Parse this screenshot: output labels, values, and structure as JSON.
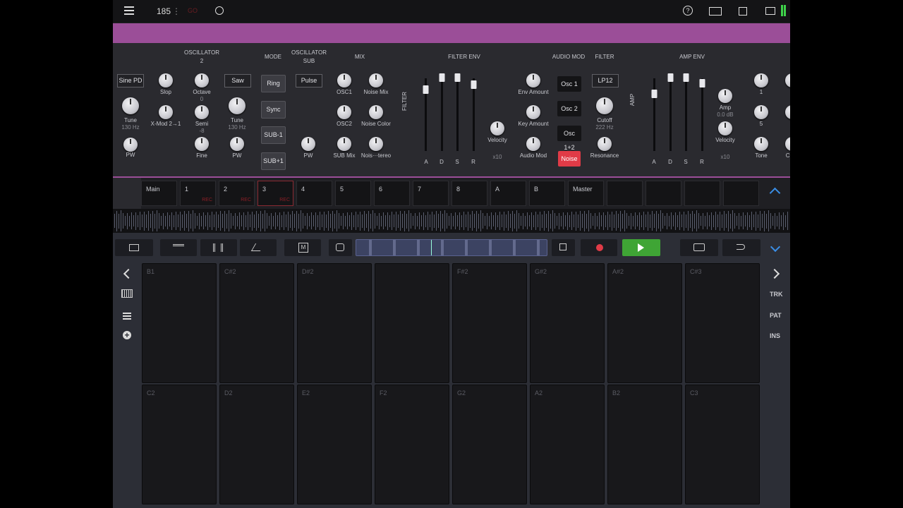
{
  "topbar": {
    "bpm": "185",
    "rec_label": "GO",
    "bpm_dots": "⋮"
  },
  "synth": {
    "headers": {
      "osc2": "OSCILLATOR\n2",
      "mode": "MODE",
      "oscsub": "OSCILLATOR\nSUB",
      "mix": "MIX",
      "filter_env": "FILTER ENV",
      "audio_mod": "AUDIO MOD",
      "filter": "FILTER",
      "amp_env": "AMP ENV",
      "filter_side": "FILTER",
      "amp_side": "AMP"
    },
    "osc1_wave": "Sine PD",
    "osc2_wave": "Saw",
    "sub_wave": "Pulse",
    "filter_type": "LP12",
    "mode_buttons": [
      "Ring",
      "Sync",
      "SUB-1",
      "SUB+1"
    ],
    "audio_mod_buttons": [
      "Osc 1",
      "Osc 2",
      "Osc 1+2",
      "Noise"
    ],
    "knobs": {
      "slop": "Slop",
      "octave": "Octave",
      "octave_val": "0",
      "tune1": "Tune",
      "tune1_val": "130 Hz",
      "xmod": "X-Mod 2→1",
      "semi": "Semi",
      "semi_val": "-8",
      "tune2": "Tune",
      "tune2_val": "130 Hz",
      "pw1": "PW",
      "fine": "Fine",
      "pw2": "PW",
      "pw3": "PW",
      "osc1": "OSC1",
      "noise_mix": "Noise Mix",
      "osc2": "OSC2",
      "noise_color": "Noise Color",
      "sub_mix": "SUB Mix",
      "noise_stereo": "Nois···tereo",
      "fe_velocity": "Velocity",
      "fe_x": "x10",
      "env_amount": "Env Amount",
      "key_amount": "Key Amount",
      "audio_mod": "Audio Mod",
      "cutoff": "Cutoff",
      "cutoff_val": "222 Hz",
      "resonance": "Resonance",
      "amp": "Amp",
      "amp_val": "0.0 dB",
      "amp_velocity": "Velocity",
      "amp_x": "x10",
      "v1": "1",
      "v5": "5",
      "tone": "Tone",
      "cr": "Cr"
    },
    "adsr": [
      "A",
      "D",
      "S",
      "R"
    ]
  },
  "tracks": [
    {
      "name": "Main",
      "rec": ""
    },
    {
      "name": "1",
      "rec": "REC"
    },
    {
      "name": "2",
      "rec": "REC"
    },
    {
      "name": "3",
      "rec": "REC"
    },
    {
      "name": "4",
      "rec": ""
    },
    {
      "name": "5",
      "rec": ""
    },
    {
      "name": "6",
      "rec": ""
    },
    {
      "name": "7",
      "rec": ""
    },
    {
      "name": "8",
      "rec": ""
    },
    {
      "name": "A",
      "rec": ""
    },
    {
      "name": "B",
      "rec": ""
    },
    {
      "name": "Master",
      "rec": ""
    },
    {
      "name": "",
      "rec": ""
    },
    {
      "name": "",
      "rec": ""
    },
    {
      "name": "",
      "rec": ""
    },
    {
      "name": "",
      "rec": ""
    }
  ],
  "pads_top": [
    "B1",
    "C#2",
    "D#2",
    "",
    "F#2",
    "G#2",
    "A#2",
    "C#3"
  ],
  "pads_bottom": [
    "C2",
    "D2",
    "E2",
    "F2",
    "G2",
    "A2",
    "B2",
    "C3"
  ],
  "side_right": {
    "trk": "TRK",
    "pat": "PAT",
    "ins": "INS"
  },
  "toolbar": {
    "m_label": "M"
  },
  "colors": {
    "accent_purple": "#9b4e98",
    "play_green": "#3fa535",
    "rec_red": "#e03b47",
    "blue": "#3a8ee6"
  }
}
